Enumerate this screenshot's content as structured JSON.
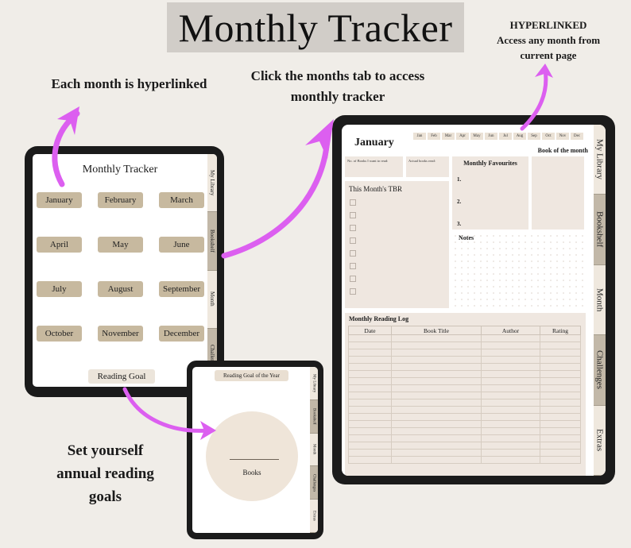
{
  "title": "Monthly Tracker",
  "captions": {
    "each_month": "Each month is hyperlinked",
    "click_tab_line1": "Click the months tab to access",
    "click_tab_line2": "monthly tracker",
    "hyperlinked_title": "HYPERLINKED",
    "hyperlinked_line1": "Access any month from",
    "hyperlinked_line2": "current page",
    "goal_line1": "Set yourself",
    "goal_line2": "annual reading",
    "goal_line3": "goals"
  },
  "side_tabs": [
    "My Library",
    "Bookshelf",
    "Month",
    "Challenges",
    "Extras"
  ],
  "index_tablet": {
    "title": "Monthly Tracker",
    "months": [
      "January",
      "February",
      "March",
      "April",
      "May",
      "June",
      "July",
      "August",
      "September",
      "October",
      "November",
      "December"
    ],
    "reading_goal_button": "Reading Goal"
  },
  "goal_tablet": {
    "header": "Reading Goal of the Year",
    "circle_label": "Books"
  },
  "month_tablet": {
    "month_title": "January",
    "month_tabs": [
      "Jan",
      "Feb",
      "Mar",
      "Apr",
      "May",
      "Jun",
      "Jul",
      "Aug",
      "Sep",
      "Oct",
      "Nov",
      "Dec"
    ],
    "book_of_month": "Book of the month",
    "books_want_label": "No. of Books I want to read:",
    "actual_books_label": "Actual books read:",
    "tbr_title": "This Month's TBR",
    "tbr_checkbox_count": 8,
    "favourites_title": "Monthly Favourites",
    "favourites": [
      "1.",
      "2.",
      "3."
    ],
    "notes_title": "Notes",
    "log_title": "Monthly Reading Log",
    "log_columns": [
      "Date",
      "Book Title",
      "Author",
      "Rating"
    ],
    "log_row_count": 18
  },
  "colors": {
    "background": "#f0ede8",
    "title_box": "#d1cdc8",
    "month_button": "#c7b99f",
    "panel": "#efe7e0",
    "arrow": "#dc5ff0",
    "tab_dark": "#c2b8a8",
    "tab_light": "#efe8de"
  }
}
